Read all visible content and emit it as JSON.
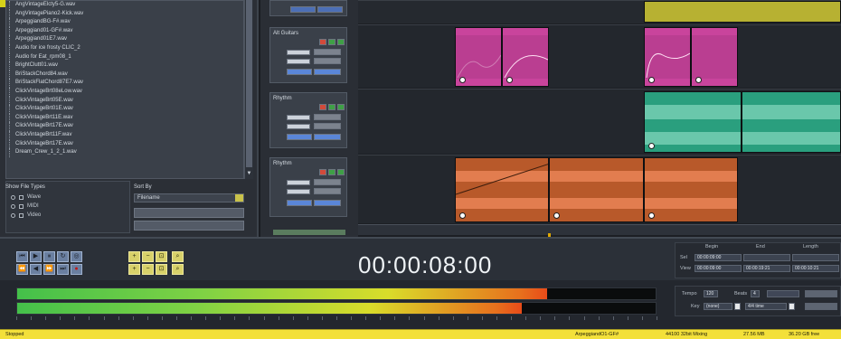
{
  "browser": {
    "files": [
      "AngVintageElcty5-G.wav",
      "AngVintagePiano2-Kick.wav",
      "ArpeggiandBG-F#.wav",
      "Arpeggiand01-GF#.wav",
      "Arpeggiand01E7.wav",
      "Audio for ice frosty CLIC_2",
      "Audio for Eat_rpm08_1",
      "BrightClutt01.wav",
      "BriStackChord84.wav",
      "BriStackFlatChord87E7.wav",
      "ClickVintageBrt08eLow.wav",
      "ClickVintageBrt05E.wav",
      "ClickVintageBrt01E.wav",
      "ClickVintageBrt11E.wav",
      "ClickVintageBrt17E.wav",
      "ClickVintageBrt11F.wav",
      "ClickVintageBrt17E.wav",
      "Dream_Crew_1_2_1.wav"
    ],
    "show_file_types": {
      "title": "Show File Types",
      "options": [
        "Wave",
        "MIDI",
        "Video"
      ]
    },
    "sort_by": {
      "title": "Sort By",
      "selected": "Filename"
    }
  },
  "tracks": [
    {
      "label": "Alt Guitars"
    },
    {
      "label": "Rhythm"
    },
    {
      "label": "Rhythm"
    }
  ],
  "transport": {
    "timecode": "00:00:08:00"
  },
  "range": {
    "headers": [
      "Begin",
      "End",
      "Length"
    ],
    "rows": [
      {
        "label": "Sel",
        "values": [
          "00:00:09:00",
          "",
          ""
        ]
      },
      {
        "label": "View",
        "values": [
          "00:00:09:00",
          "00:00:19:21",
          "00:00:10:21"
        ]
      }
    ]
  },
  "tempo": {
    "tempo_label": "Tempo",
    "tempo_value": "120",
    "beats_label": "Beats",
    "beats_value": "4",
    "key_label": "Key",
    "key_value": "(none)",
    "time_sig": "4/4 time"
  },
  "meters": {
    "levels": [
      0.83,
      0.79
    ]
  },
  "status": {
    "state": "Stopped",
    "file": "ArpeggiandO1-GF#",
    "format": "44100  32bit Mixing",
    "memory": "27.56 MB",
    "disk": "36.20 GB free"
  },
  "colors": {
    "meter_low": "#44c04a",
    "meter_high": "#e84b19",
    "clip_pink": "#d94aa6",
    "clip_teal": "#2fae88",
    "clip_orange": "#c8612b",
    "clip_yellow": "#c8c330",
    "status_yellow": "#f3e03a"
  }
}
